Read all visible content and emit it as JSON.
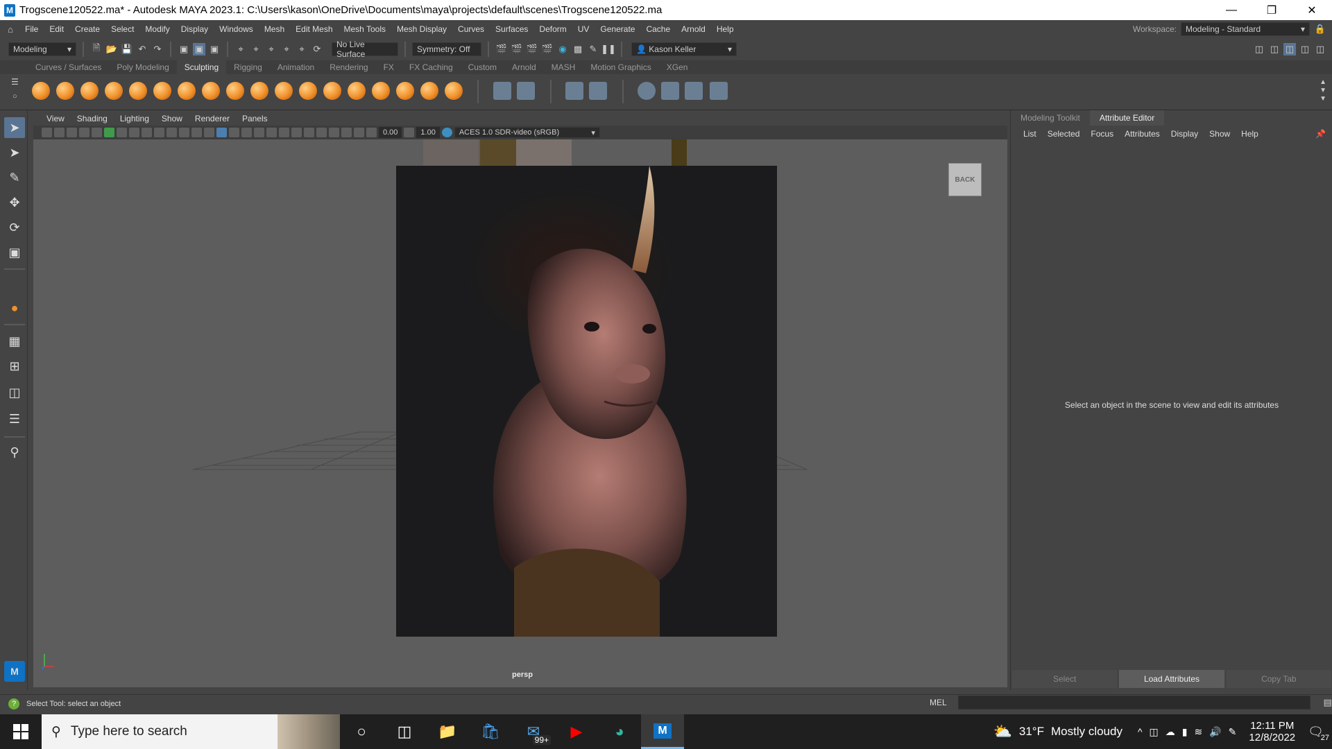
{
  "window": {
    "title": "Trogscene120522.ma* - Autodesk MAYA 2023.1: C:\\Users\\kason\\OneDrive\\Documents\\maya\\projects\\default\\scenes\\Trogscene120522.ma",
    "app_icon": "M"
  },
  "menubar": {
    "items": [
      "File",
      "Edit",
      "Create",
      "Select",
      "Modify",
      "Display",
      "Windows",
      "Mesh",
      "Edit Mesh",
      "Mesh Tools",
      "Mesh Display",
      "Curves",
      "Surfaces",
      "Deform",
      "UV",
      "Generate",
      "Cache",
      "Arnold",
      "Help"
    ],
    "workspace_label": "Workspace:",
    "workspace_value": "Modeling - Standard"
  },
  "statusline": {
    "mode": "Modeling",
    "live_surface": "No Live Surface",
    "symmetry": "Symmetry: Off",
    "user": "Kason Keller"
  },
  "shelf": {
    "tabs": [
      "Curves / Surfaces",
      "Poly Modeling",
      "Sculpting",
      "Rigging",
      "Animation",
      "Rendering",
      "FX",
      "FX Caching",
      "Custom",
      "Arnold",
      "MASH",
      "Motion Graphics",
      "XGen"
    ],
    "active_tab": "Sculpting"
  },
  "viewport": {
    "menu": [
      "View",
      "Shading",
      "Lighting",
      "Show",
      "Renderer",
      "Panels"
    ],
    "value_a": "0.00",
    "value_b": "1.00",
    "colorspace": "ACES 1.0 SDR-video (sRGB)",
    "camera_label": "persp",
    "viewcube_label": "BACK"
  },
  "right_panel": {
    "tabs": [
      "Modeling Toolkit",
      "Attribute Editor"
    ],
    "active_tab": "Attribute Editor",
    "menu": [
      "List",
      "Selected",
      "Focus",
      "Attributes",
      "Display",
      "Show",
      "Help"
    ],
    "message": "Select an object in the scene to view and edit its attributes",
    "buttons": [
      "Select",
      "Load Attributes",
      "Copy Tab"
    ]
  },
  "helpline": {
    "text": "Select Tool: select an object",
    "mel_label": "MEL"
  },
  "taskbar": {
    "search_placeholder": "Type here to search",
    "mail_badge": "99+",
    "weather_temp": "31°F",
    "weather_text": "Mostly cloudy",
    "time": "12:11 PM",
    "date": "12/8/2022",
    "notifications": "27"
  }
}
